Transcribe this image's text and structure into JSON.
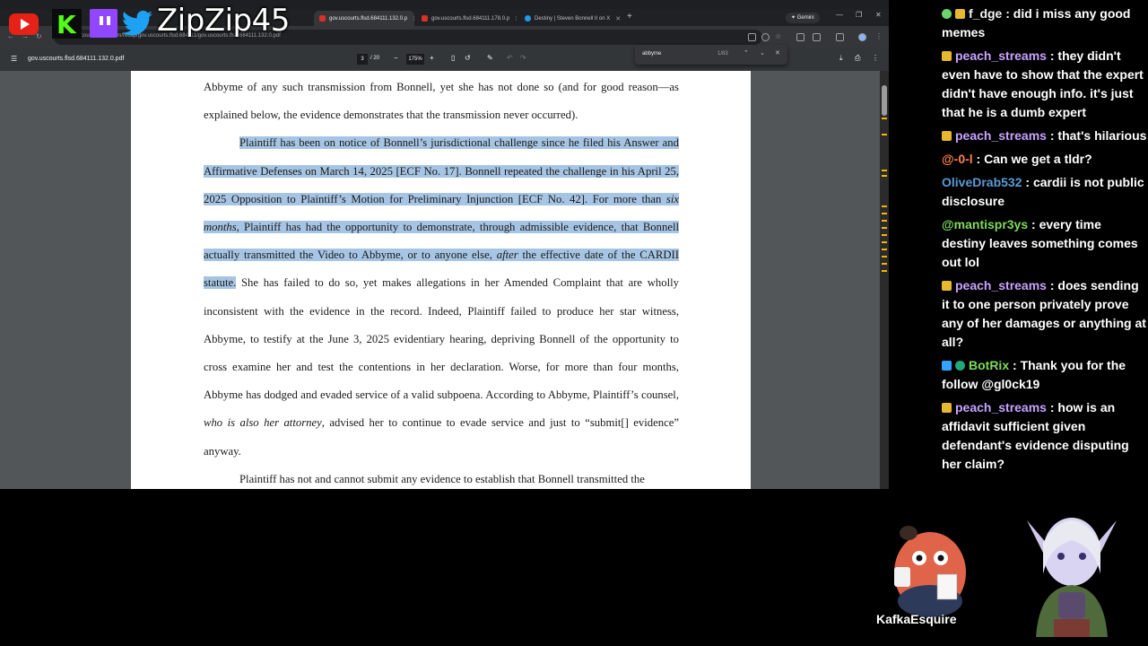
{
  "browser": {
    "tabs": [
      {
        "label": "gov.uscourts.flsd.684111.132.0.p",
        "active": true
      },
      {
        "label": "gov.uscourts.flsd.684111.178.0.p",
        "active": false
      },
      {
        "label": "Destiny | Steven Bonnell II on X",
        "active": false
      }
    ],
    "gemini_label": "Gemini",
    "url": "courtlistener.com/recap/gov.uscourts.flsd.684111/gov.uscourts.flsd.684111.132.0.pdf"
  },
  "find": {
    "query": "abbyme",
    "count": "1/83"
  },
  "pdf": {
    "filename": "gov.uscourts.flsd.684111.132.0.pdf",
    "page": "3",
    "page_total": "/ 20",
    "zoom": "175%",
    "p1": "Abbyme of any such transmission from Bonnell, yet she has not done so (and for good reason—as explained below, the evidence demonstrates that the transmission never occurred).",
    "p2_hl_a": "Plaintiff has been on notice of Bonnell’s jurisdictional challenge since he filed his Answer and Affirmative Defenses on March 14, 2025 [ECF No. 17]. Bonnell repeated the challenge in his April 25, 2025 Opposition to Plaintiff’s Motion for Preliminary Injunction [ECF No. 42]. For more than ",
    "p2_hl_em1": "six months",
    "p2_hl_b": ", Plaintiff has had the opportunity to demonstrate, through admissible evidence, that Bonnell actually transmitted the Video to Abbyme, or to anyone else, ",
    "p2_hl_em2": "after",
    "p2_hl_c": " the effective date of the CARDII statute.",
    "p2_rest_a": " She has failed to do so, yet makes allegations in her Amended Complaint that are wholly inconsistent with the evidence in the record. Indeed, Plaintiff failed to produce her star witness, Abbyme, to testify at the June 3, 2025 evidentiary hearing, depriving Bonnell of the opportunity to cross examine her and test the contentions in her declaration. Worse, for more than four months, Abbyme has dodged and evaded service of a valid subpoena. According to Abbyme, Plaintiff’s counsel, ",
    "p2_rest_em": "who is also her attorney",
    "p2_rest_b": ", advised her to continue to evade service and just to “submit[] evidence” anyway.",
    "p3": "Plaintiff has not and cannot submit any evidence to establish that Bonnell transmitted the"
  },
  "overlay": {
    "username": "ZipZip45"
  },
  "chat": [
    {
      "badges": [
        "green",
        "sub"
      ],
      "author": "f_dge",
      "color": "#f0f0f0",
      "text": "did i miss any good memes"
    },
    {
      "badges": [
        "sub"
      ],
      "author": "peach_streams",
      "color": "#c8a2ff",
      "text": "they didn't even have to show that the expert didn't have enough info. it's just that he is a dumb expert"
    },
    {
      "badges": [
        "sub"
      ],
      "author": "peach_streams",
      "color": "#c8a2ff",
      "text": "that's hilarious"
    },
    {
      "badges": [],
      "author": "@-0-l",
      "color": "#ff7f50",
      "text": "Can we get a tldr?"
    },
    {
      "badges": [],
      "author": "OliveDrab532",
      "color": "#5a9bd5",
      "text": "cardii is not public disclosure"
    },
    {
      "badges": [],
      "author": "@mantispr3ys",
      "color": "#7ddc5a",
      "text": "every time destiny leaves something comes out lol"
    },
    {
      "badges": [
        "sub"
      ],
      "author": "peach_streams",
      "color": "#c8a2ff",
      "text": "does sending it to one person privately prove any of her damages or anything at all?"
    },
    {
      "badges": [
        "blue",
        "verified"
      ],
      "author": "BotRix",
      "color": "#7ddc5a",
      "text": "Thank you for the follow @gl0ck19"
    },
    {
      "badges": [
        "sub"
      ],
      "author": "peach_streams",
      "color": "#c8a2ff",
      "text": "how is an affidavit sufficient given defendant's evidence disputing her claim?"
    }
  ],
  "characters": {
    "left_label": "KafkaEsquire"
  }
}
